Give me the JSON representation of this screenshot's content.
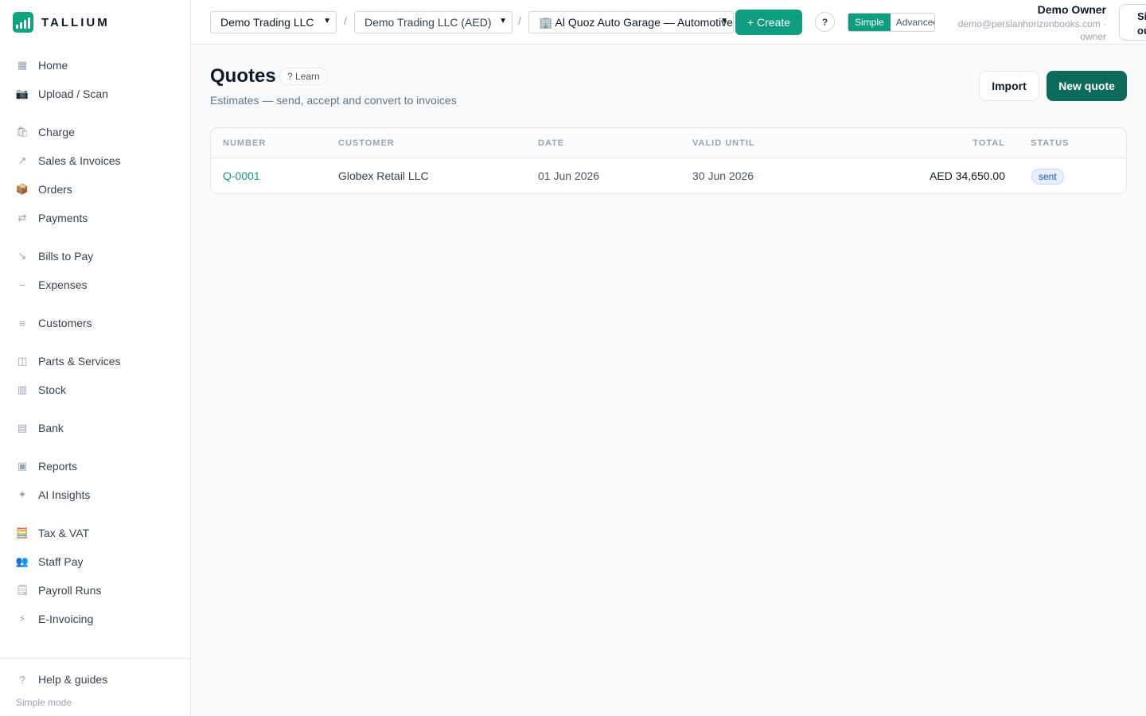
{
  "brand": {
    "name": "TALLIUM",
    "accent": "#0f9d7f"
  },
  "sidebar": {
    "items": [
      {
        "label": "Home",
        "icon": "▦"
      },
      {
        "label": "Upload / Scan",
        "icon": "📷"
      },
      {
        "label": "Charge",
        "icon": "🛍"
      },
      {
        "label": "Sales & Invoices",
        "icon": "↗"
      },
      {
        "label": "Orders",
        "icon": "📦"
      },
      {
        "label": "Payments",
        "icon": "⇄"
      },
      {
        "label": "Bills to Pay",
        "icon": "↘"
      },
      {
        "label": "Expenses",
        "icon": "−"
      },
      {
        "label": "Customers",
        "icon": "≡"
      },
      {
        "label": "Parts & Services",
        "icon": "◫"
      },
      {
        "label": "Stock",
        "icon": "▥"
      },
      {
        "label": "Bank",
        "icon": "▤"
      },
      {
        "label": "Reports",
        "icon": "▣"
      },
      {
        "label": "AI Insights",
        "icon": "✦"
      },
      {
        "label": "Tax & VAT",
        "icon": "🧮"
      },
      {
        "label": "Staff Pay",
        "icon": "👥"
      },
      {
        "label": "Payroll Runs",
        "icon": "🗒"
      },
      {
        "label": "E-Invoicing",
        "icon": "⚡"
      }
    ],
    "footer": {
      "help": {
        "label": "Help & guides",
        "icon": "?"
      },
      "mode_note": "Simple mode"
    }
  },
  "topbar": {
    "org_select": "Demo Trading LLC",
    "entity_select": "Demo Trading LLC (AED)",
    "branch_select": "🏢 Al Quoz Auto Garage — Automotive",
    "create_label": "+ Create",
    "help_label": "?",
    "mode_simple": "Simple",
    "mode_advanced": "Advanced",
    "user_name": "Demo Owner",
    "user_email": "demo@persianhorizonbooks.com ·",
    "user_role": "owner",
    "signout_label": "Sign out"
  },
  "page": {
    "title": "Quotes",
    "learn_label": "? Learn",
    "subtitle": "Estimates — send, accept and convert to invoices",
    "import_label": "Import",
    "new_label": "New quote"
  },
  "table": {
    "headers": {
      "number": "NUMBER",
      "customer": "CUSTOMER",
      "date": "DATE",
      "valid_until": "VALID UNTIL",
      "total": "TOTAL",
      "status": "STATUS"
    },
    "rows": [
      {
        "number": "Q-0001",
        "customer": "Globex Retail LLC",
        "date": "01 Jun 2026",
        "valid_until": "30 Jun 2026",
        "total": "AED 34,650.00",
        "status": "sent"
      }
    ]
  }
}
